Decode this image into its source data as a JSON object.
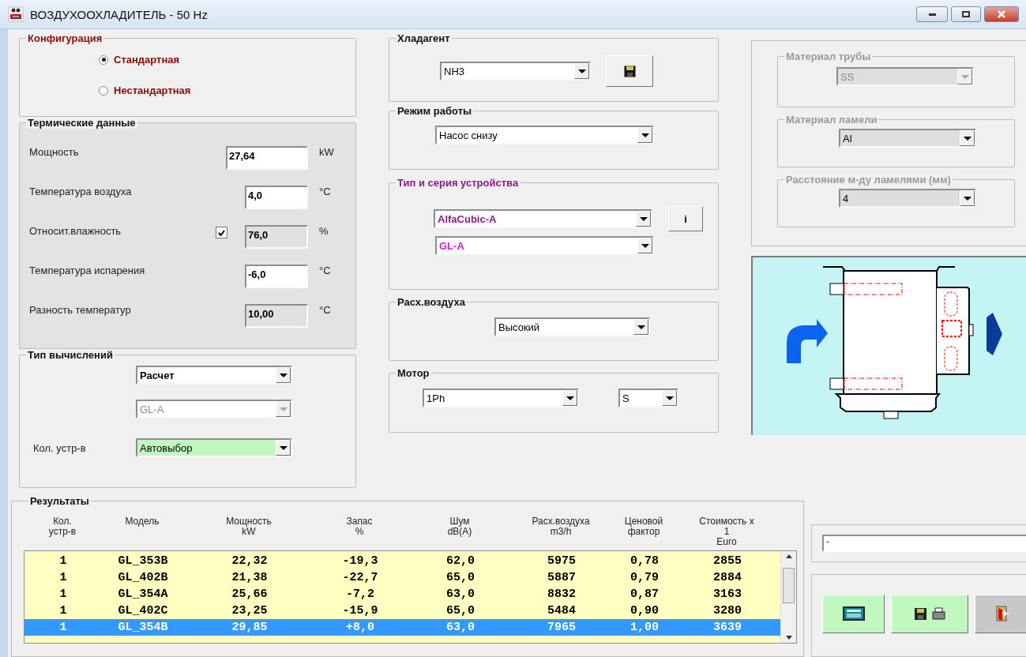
{
  "window": {
    "title": "ВОЗДУХООХЛАДИТЕЛЬ - 50 Hz"
  },
  "configuration": {
    "title": "Конфигурация",
    "options": [
      {
        "label": "Стандартная",
        "selected": true
      },
      {
        "label": "Нестандартная",
        "selected": false
      }
    ]
  },
  "thermal_data": {
    "title": "Термические данные",
    "rows": [
      {
        "label": "Мощность",
        "value": "27,64",
        "unit": "kW",
        "kind": "wide"
      },
      {
        "label": "Температура воздуха",
        "value": "4,0",
        "unit": "°C",
        "kind": "input"
      },
      {
        "label": "Относит.влажность",
        "value": "76,0",
        "unit": "%",
        "kind": "readonly",
        "checkbox": {
          "checked": true
        }
      },
      {
        "label": "Температура испарения",
        "value": "-6,0",
        "unit": "°C",
        "kind": "input"
      },
      {
        "label": "Разность температур",
        "value": "10,00",
        "unit": "°C",
        "kind": "readonly"
      }
    ]
  },
  "calculation": {
    "title": "Тип вычислений",
    "mode": "Расчет",
    "series": {
      "value": "GL-A",
      "disabled": true
    },
    "count_label": "Кол. устр-в",
    "count_value": "Автовыбор"
  },
  "refrigerant": {
    "title": "Хладагент",
    "value": "NH3"
  },
  "operating_mode": {
    "title": "Режим работы",
    "value": "Насос снизу"
  },
  "device": {
    "title": "Тип и серия устройства",
    "type": "AlfaCubic-A",
    "series": "GL-A",
    "info_button": "i"
  },
  "airflow": {
    "title": "Расх.воздуха",
    "value": "Высокий"
  },
  "motor": {
    "title": "Мотор",
    "phase": "1Ph",
    "size": "S"
  },
  "materials": [
    {
      "title": "Материал трубы",
      "value": "SS",
      "disabled": true
    },
    {
      "title": "Материал ламели",
      "value": "Al",
      "disabled": false
    },
    {
      "title": "Расстояние м-ду ламелями (мм)",
      "value": "4",
      "disabled": false
    }
  ],
  "results": {
    "title": "Результаты",
    "columns": [
      "Кол.\nустр-в",
      "Модель",
      "Мощность\nkW",
      "Запас\n%",
      "Шум\ndB(A)",
      "Расх.воздуха\nm3/h",
      "Ценовой\nфактор",
      "Стоимость x\n1\nEuro"
    ],
    "rows": [
      {
        "cells": [
          "1",
          "GL_353B",
          "22,32",
          "-19,3",
          "62,0",
          "5975",
          "0,78",
          "2855"
        ],
        "selected": false
      },
      {
        "cells": [
          "1",
          "GL_402B",
          "21,38",
          "-22,7",
          "65,0",
          "5887",
          "0,79",
          "2884"
        ],
        "selected": false
      },
      {
        "cells": [
          "1",
          "GL_354A",
          "25,66",
          "-7,2",
          "63,0",
          "8832",
          "0,87",
          "3163"
        ],
        "selected": false
      },
      {
        "cells": [
          "1",
          "GL_402C",
          "23,25",
          "-15,9",
          "65,0",
          "5484",
          "0,90",
          "3280"
        ],
        "selected": false
      },
      {
        "cells": [
          "1",
          "GL_354B",
          "29,85",
          "+8,0",
          "63,0",
          "7965",
          "1,00",
          "3639"
        ],
        "selected": true
      }
    ]
  },
  "status_field": {
    "value": "-"
  }
}
